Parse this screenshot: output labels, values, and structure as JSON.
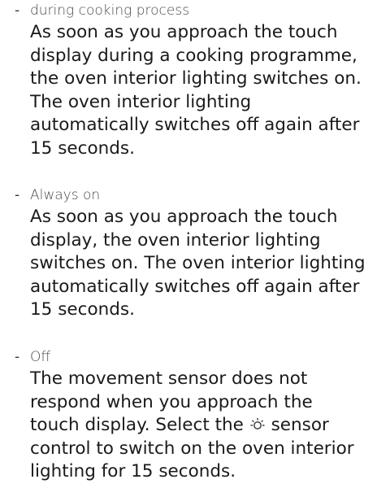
{
  "options": [
    {
      "term": "during cooking process",
      "lines": [
        "As soon as you approach the touch",
        "display during a cooking programme,",
        "the oven interior lighting switches on.",
        "The oven interior lighting",
        "automatically switches off again after",
        "15 seconds."
      ]
    },
    {
      "term": "Always on",
      "lines": [
        "As soon as you approach the touch",
        "display, the oven interior lighting",
        "switches on. The oven interior lighting",
        "automatically switches off again after",
        "15 seconds."
      ]
    },
    {
      "term": "Off",
      "lines": [
        "The movement sensor does not",
        "respond when you approach the",
        "touch display. Select the",
        "sensor",
        "control to switch on the oven interior",
        "lighting for 15 seconds."
      ],
      "icon": "light-bulb-icon"
    }
  ],
  "dash": "-"
}
